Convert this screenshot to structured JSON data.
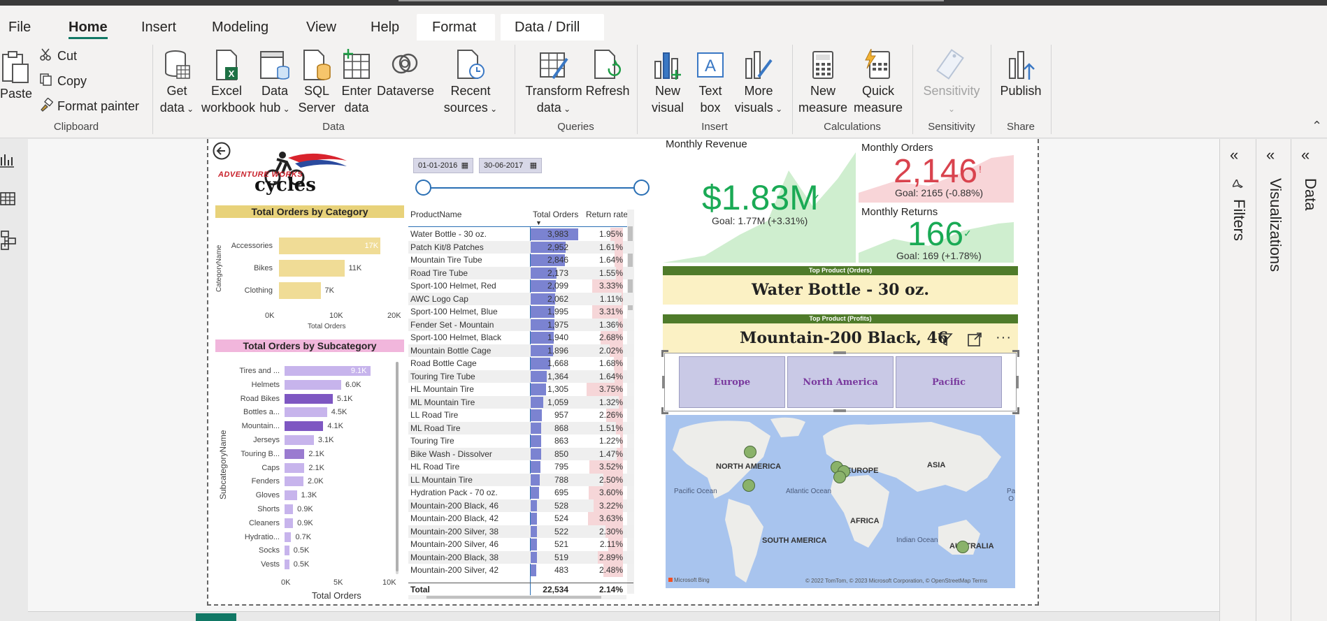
{
  "tabs": [
    "File",
    "Home",
    "Insert",
    "Modeling",
    "View",
    "Help",
    "Format",
    "Data / Drill"
  ],
  "clipboard": {
    "paste": "Paste",
    "cut": "Cut",
    "copy": "Copy",
    "format_painter": "Format painter",
    "label": "Clipboard"
  },
  "data_group": {
    "get_data": [
      "Get",
      "data"
    ],
    "excel": [
      "Excel",
      "workbook"
    ],
    "hub": [
      "Data",
      "hub"
    ],
    "sql": [
      "SQL",
      "Server"
    ],
    "enter": [
      "Enter",
      "data"
    ],
    "dataverse": "Dataverse",
    "recent": [
      "Recent",
      "sources"
    ],
    "label": "Data"
  },
  "queries": {
    "transform": [
      "Transform",
      "data"
    ],
    "refresh": "Refresh",
    "label": "Queries"
  },
  "insert": {
    "new_visual": [
      "New",
      "visual"
    ],
    "text_box": [
      "Text",
      "box"
    ],
    "more_visuals": [
      "More",
      "visuals"
    ],
    "label": "Insert"
  },
  "calculations": {
    "new_measure": [
      "New",
      "measure"
    ],
    "quick_measure": [
      "Quick",
      "measure"
    ],
    "label": "Calculations"
  },
  "sensitivity": {
    "btn": "Sensitivity",
    "label": "Sensitivity"
  },
  "share": {
    "publish": "Publish",
    "label": "Share"
  },
  "panes": {
    "filters": "Filters",
    "visualizations": "Visualizations",
    "data": "Data"
  },
  "slicer": {
    "start": "01-01-2016",
    "end": "30-06-2017"
  },
  "logo": {
    "line1": "ADVENTURE WORKS",
    "line2": "cycles"
  },
  "category_chart": {
    "title": "Total Orders by Category",
    "ylabel": "CategoryName",
    "xlabel": "Total Orders",
    "ticks": [
      "0K",
      "10K",
      "20K"
    ]
  },
  "subcategory_chart": {
    "title": "Total Orders by Subcategory",
    "ylabel": "SubcategoryName",
    "xlabel": "Total Orders",
    "ticks": [
      "0K",
      "5K",
      "10K"
    ]
  },
  "table": {
    "headers": [
      "ProductName",
      "Total Orders",
      "Return rate"
    ],
    "total": {
      "label": "Total",
      "orders": "22,534",
      "rate": "2.14%"
    }
  },
  "kpis": {
    "revenue": {
      "title": "Monthly Revenue",
      "value": "$1.83M",
      "goal": "Goal: 1.77M (+3.31%)"
    },
    "orders": {
      "title": "Monthly Orders",
      "value": "2,146",
      "goal": "Goal: 2165 (-0.88%)"
    },
    "returns": {
      "title": "Monthly Returns",
      "value": "166",
      "goal": "Goal: 169 (+1.78%)"
    }
  },
  "top_orders": {
    "label": "Top Product (Orders)",
    "value": "Water Bottle - 30 oz."
  },
  "top_profits": {
    "label": "Top Product (Profits)",
    "value": "Mountain-200 Black, 46"
  },
  "regions": [
    "Europe",
    "North America",
    "Pacific"
  ],
  "map": {
    "continents": [
      "NORTH AMERICA",
      "EUROPE",
      "ASIA",
      "AFRICA",
      "SOUTH AMERICA",
      "AUSTRALIA"
    ],
    "oceans": [
      "Pacific\nOcean",
      "Atlantic\nOcean",
      "Indian\nOcean",
      "Pa\nO"
    ],
    "credit": "Microsoft Bing",
    "copyright": "© 2022 TomTom, © 2023 Microsoft Corporation, © OpenStreetMap  Terms"
  },
  "colors": {
    "accent": "#117865",
    "kpi_green": "#1aaa55",
    "kpi_red": "#d9434e",
    "banner_green": "#4f7b2a",
    "banner_bg": "#fbf1c4",
    "table_bar": "#7b83d1"
  },
  "chart_data": [
    {
      "type": "bar",
      "title": "Total Orders by Category",
      "categories": [
        "Accessories",
        "Bikes",
        "Clothing"
      ],
      "values": [
        17000,
        11000,
        7000
      ],
      "labels": [
        "17K",
        "11K",
        "7K"
      ],
      "xlabel": "Total Orders",
      "ylabel": "CategoryName",
      "xlim": [
        0,
        20000
      ]
    },
    {
      "type": "bar",
      "title": "Total Orders by Subcategory",
      "categories": [
        "Tires and ...",
        "Helmets",
        "Road Bikes",
        "Bottles a...",
        "Mountain...",
        "Jerseys",
        "Touring B...",
        "Caps",
        "Fenders",
        "Gloves",
        "Shorts",
        "Cleaners",
        "Hydratio...",
        "Socks",
        "Vests"
      ],
      "values": [
        9100,
        6000,
        5100,
        4500,
        4100,
        3100,
        2100,
        2100,
        2000,
        1300,
        900,
        900,
        700,
        500,
        500
      ],
      "labels": [
        "9.1K",
        "6.0K",
        "5.1K",
        "4.5K",
        "4.1K",
        "3.1K",
        "2.1K",
        "2.1K",
        "2.0K",
        "1.3K",
        "0.9K",
        "0.9K",
        "0.7K",
        "0.5K",
        "0.5K"
      ],
      "xlabel": "Total Orders",
      "ylabel": "SubcategoryName",
      "xlim": [
        0,
        10000
      ]
    },
    {
      "type": "table",
      "columns": [
        "ProductName",
        "Total Orders",
        "Return rate"
      ],
      "rows": [
        [
          "Water Bottle - 30 oz.",
          "3,983",
          "1.95%"
        ],
        [
          "Patch Kit/8 Patches",
          "2,952",
          "1.61%"
        ],
        [
          "Mountain Tire Tube",
          "2,846",
          "1.64%"
        ],
        [
          "Road Tire Tube",
          "2,173",
          "1.55%"
        ],
        [
          "Sport-100 Helmet, Red",
          "2,099",
          "3.33%"
        ],
        [
          "AWC Logo Cap",
          "2,062",
          "1.11%"
        ],
        [
          "Sport-100 Helmet, Blue",
          "1,995",
          "3.31%"
        ],
        [
          "Fender Set - Mountain",
          "1,975",
          "1.36%"
        ],
        [
          "Sport-100 Helmet, Black",
          "1,940",
          "2.68%"
        ],
        [
          "Mountain Bottle Cage",
          "1,896",
          "2.02%"
        ],
        [
          "Road Bottle Cage",
          "1,668",
          "1.68%"
        ],
        [
          "Touring Tire Tube",
          "1,364",
          "1.64%"
        ],
        [
          "HL Mountain Tire",
          "1,305",
          "3.75%"
        ],
        [
          "ML Mountain Tire",
          "1,059",
          "1.32%"
        ],
        [
          "LL Road Tire",
          "957",
          "2.26%"
        ],
        [
          "ML Road Tire",
          "868",
          "1.51%"
        ],
        [
          "Touring Tire",
          "863",
          "1.22%"
        ],
        [
          "Bike Wash - Dissolver",
          "850",
          "1.47%"
        ],
        [
          "HL Road Tire",
          "795",
          "3.52%"
        ],
        [
          "LL Mountain Tire",
          "788",
          "2.50%"
        ],
        [
          "Hydration Pack - 70 oz.",
          "695",
          "3.60%"
        ],
        [
          "Mountain-200 Black, 46",
          "528",
          "3.22%"
        ],
        [
          "Mountain-200 Black, 42",
          "524",
          "3.63%"
        ],
        [
          "Mountain-200 Silver, 38",
          "522",
          "2.30%"
        ],
        [
          "Mountain-200 Silver, 46",
          "521",
          "2.11%"
        ],
        [
          "Mountain-200 Black, 38",
          "519",
          "2.89%"
        ],
        [
          "Mountain-200 Silver, 42",
          "483",
          "2.48%"
        ]
      ]
    }
  ]
}
